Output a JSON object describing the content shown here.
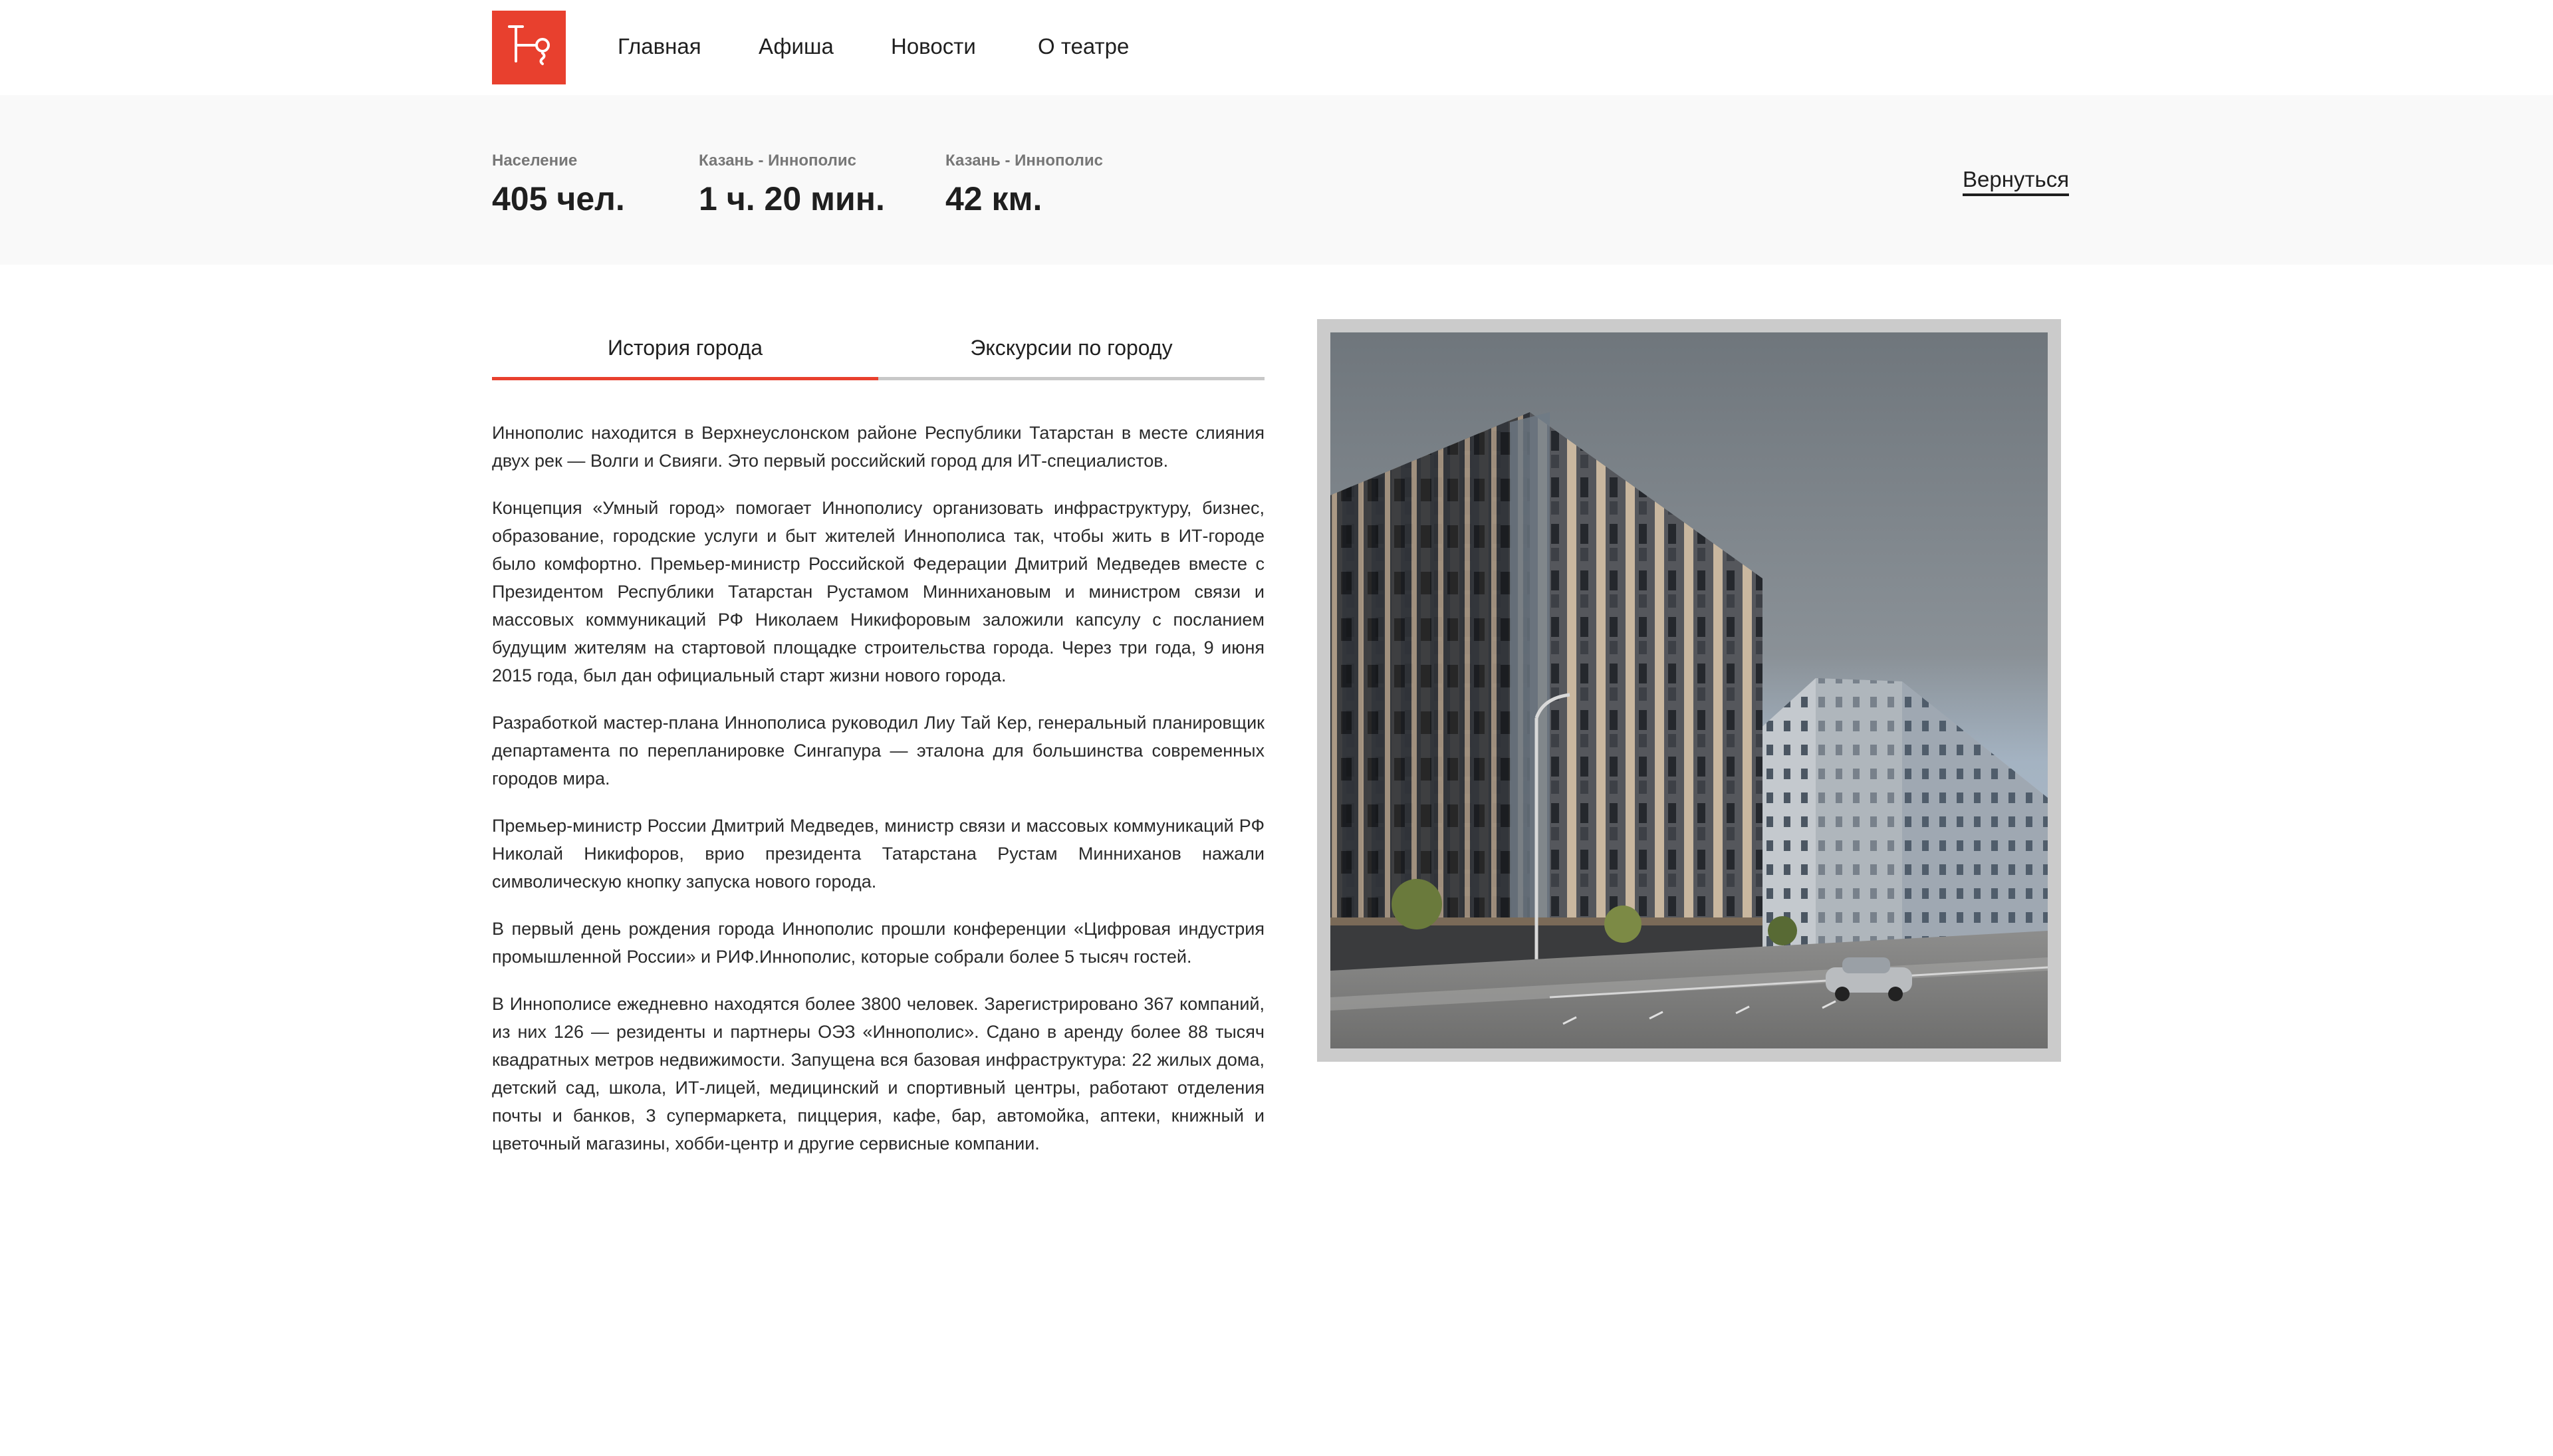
{
  "header": {
    "logo_name": "theatre-logo",
    "nav": [
      {
        "label": "Главная"
      },
      {
        "label": "Афиша"
      },
      {
        "label": "Новости"
      },
      {
        "label": "О театре"
      }
    ]
  },
  "stats": [
    {
      "label": "Население",
      "value": "405 чел."
    },
    {
      "label": "Казань - Иннополис",
      "value": "1 ч. 20 мин."
    },
    {
      "label": "Казань - Иннополис",
      "value": "42 км."
    }
  ],
  "back_link": "Вернуться",
  "tabs": [
    {
      "label": "История города",
      "active": true
    },
    {
      "label": "Экскурсии по городу",
      "active": false
    }
  ],
  "article": {
    "paragraphs": [
      "Иннополис находится в Верхнеуслонском районе Республики Татарстан в месте слияния двух рек — Волги и Свияги. Это первый российский город для ИТ-специалистов.",
      "Концепция «Умный город» помогает Иннополису организовать инфраструктуру, бизнес, образование, городские услуги и быт жителей Иннополиса так, чтобы жить в ИТ-городе было комфортно. Премьер-министр Российской Федерации Дмитрий Медведев вместе с Президентом Республики Татарстан Рустамом Миннихановым и министром связи и массовых коммуникаций РФ Николаем Никифоровым заложили капсулу с посланием будущим жителям на стартовой площадке строительства города. Через три года, 9 июня 2015 года, был дан официальный старт жизни нового города.",
      "Разработкой мастер-плана Иннополиса руководил Лиу Тай Кер, генеральный планировщик департамента по перепланировке Сингапура — эталона для большинства современных городов мира.",
      "Премьер-министр России Дмитрий Медведев, министр связи и массовых коммуникаций РФ Николай Никифоров, врио президента Татарстана Рустам Минниханов нажали символическую кнопку запуска нового города.",
      "В первый день рождения города Иннополис прошли конференции «Цифровая индустрия промышленной России» и РИФ.Иннополис, которые собрали более 5 тысяч гостей.",
      "В Иннополисе ежедневно находятся более 3800 человек. Зарегистрировано 367 компаний, из них 126 — резиденты и партнеры ОЭЗ «Иннополис». Сдано в аренду более 88 тысяч квадратных метров недвижимости. Запущена вся базовая инфраструктура: 22 жилых дома, детский сад, школа, ИТ-лицей, медицинский и спортивный центры, работают отделения почты и банков, 3 супермаркета, пиццерия, кафе, бар, автомойка, аптеки, книжный и цветочный магазины, хобби-центр и другие сервисные компании."
    ]
  },
  "colors": {
    "accent": "#e8402e",
    "stats_bg": "#f9f9f9",
    "text": "#1f1f1f"
  }
}
